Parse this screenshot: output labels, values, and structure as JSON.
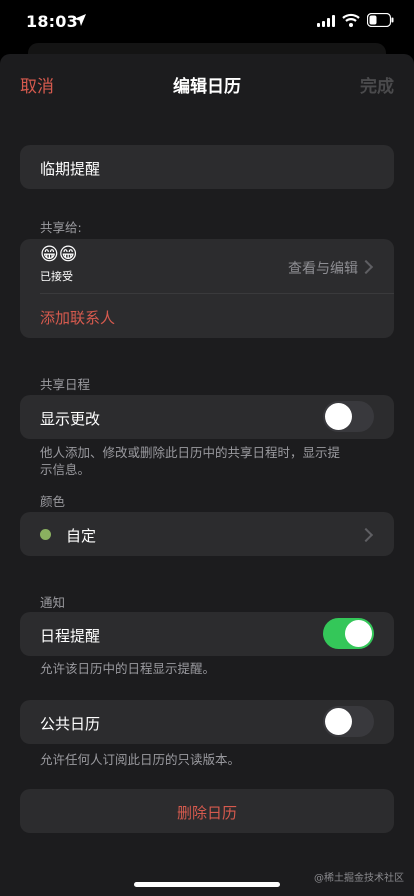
{
  "status_bar": {
    "time": "18:03"
  },
  "nav": {
    "cancel": "取消",
    "title": "编辑日历",
    "done": "完成"
  },
  "calendar_name": "临期提醒",
  "shared_with": {
    "label": "共享给:",
    "member_emoji": "😁😁",
    "member_status": "已接受",
    "permission": "查看与编辑",
    "add_contact": "添加联系人"
  },
  "shared_events": {
    "label": "共享日程",
    "show_changes": {
      "label": "显示更改",
      "on": false
    },
    "footnote": "他人添加、修改或删除此日历中的共享日程时，显示提示信息。"
  },
  "color": {
    "label": "颜色",
    "value": "自定",
    "swatch": "#8ab060"
  },
  "notifications": {
    "label": "通知",
    "event_alerts": {
      "label": "日程提醒",
      "on": true
    },
    "footnote": "允许该日历中的日程显示提醒。"
  },
  "public_calendar": {
    "label": "公共日历",
    "on": false,
    "footnote": "允许任何人订阅此日历的只读版本。"
  },
  "delete_button": "删除日历",
  "watermark": "@稀土掘金技术社区",
  "colors": {
    "accent_red": "#d65a4e",
    "toggle_on": "#34c759",
    "card_bg": "#2c2c2e"
  }
}
